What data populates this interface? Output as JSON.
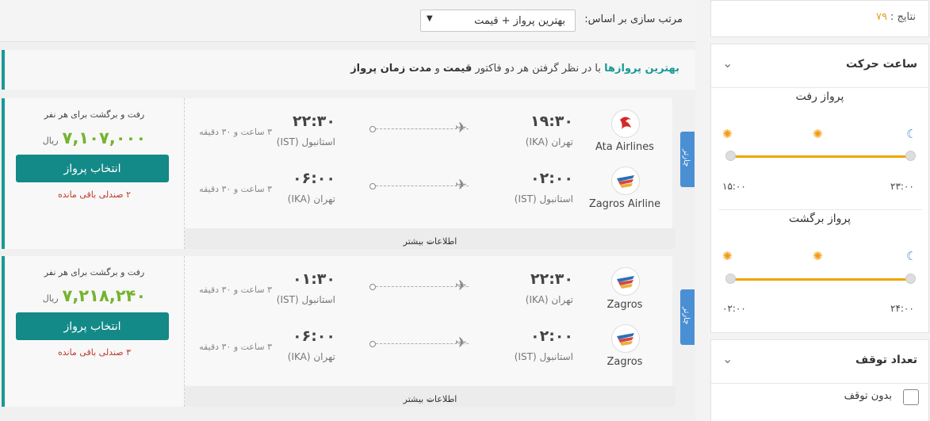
{
  "sort": {
    "label": "مرتب سازی بر اساس:",
    "selected": "بهترین پرواز + قیمت"
  },
  "banner": {
    "highlight": "بهترین پروازها",
    "text1": " با در نظر گرفتن هر دو فاکتور ",
    "bold1": "قیمت",
    "text2": " و ",
    "bold2": "مدت زمان پرواز"
  },
  "flights": [
    {
      "price_caption": "رفت و برگشت برای هر نفر",
      "price": "۷,۱۰۷,۰۰۰",
      "currency": "ریال",
      "select_label": "انتخاب پرواز",
      "seats": "۲ صندلی باقی مانده",
      "charter_label": "چارتر",
      "more_info": "اطلاعات بیشتر",
      "segments": [
        {
          "airline": "Ata Airlines",
          "logo": "ata-airlines-logo",
          "dep_time": "۱۹:۳۰",
          "dep_city": "تهران (IKA)",
          "arr_time": "۲۲:۳۰",
          "arr_city": "استانبول (IST)",
          "duration": "۳ ساعت و ۳۰ دقیقه"
        },
        {
          "airline": "Zagros Airline",
          "logo": "zagros-logo",
          "dep_time": "۰۲:۰۰",
          "dep_city": "استانبول (IST)",
          "arr_time": "۰۶:۰۰",
          "arr_city": "تهران (IKA)",
          "duration": "۳ ساعت و ۳۰ دقیقه"
        }
      ]
    },
    {
      "price_caption": "رفت و برگشت برای هر نفر",
      "price": "۷,۲۱۸,۲۴۰",
      "currency": "ریال",
      "select_label": "انتخاب پرواز",
      "seats": "۳ صندلی باقی مانده",
      "charter_label": "چارتر",
      "more_info": "اطلاعات بیشتر",
      "segments": [
        {
          "airline": "Zagros",
          "logo": "zagros-logo",
          "dep_time": "۲۲:۳۰",
          "dep_city": "تهران (IKA)",
          "arr_time": "۰۱:۳۰",
          "arr_city": "استانبول (IST)",
          "duration": "۳ ساعت و ۳۰ دقیقه"
        },
        {
          "airline": "Zagros",
          "logo": "zagros-logo",
          "dep_time": "۰۲:۰۰",
          "dep_city": "استانبول (IST)",
          "arr_time": "۰۶:۰۰",
          "arr_city": "تهران (IKA)",
          "duration": "۳ ساعت و ۳۰ دقیقه"
        }
      ]
    }
  ],
  "sidebar": {
    "results_label": "نتایج :",
    "results_count": "۷۹",
    "departure_time": {
      "title": "ساعت حرکت",
      "outbound_title": "پرواز رفت",
      "outbound_min": "۱۵:۰۰",
      "outbound_max": "۲۳:۰۰",
      "return_title": "پرواز برگشت",
      "return_min": "۰۲:۰۰",
      "return_max": "۲۴:۰۰"
    },
    "stops": {
      "title": "تعداد توقف",
      "nonstop_label": "بدون توقف"
    }
  },
  "colors": {
    "accent": "#1a9a96",
    "price": "#74b42f",
    "button": "#138a87",
    "slider": "#f0a500",
    "charter": "#4a8fd4"
  }
}
